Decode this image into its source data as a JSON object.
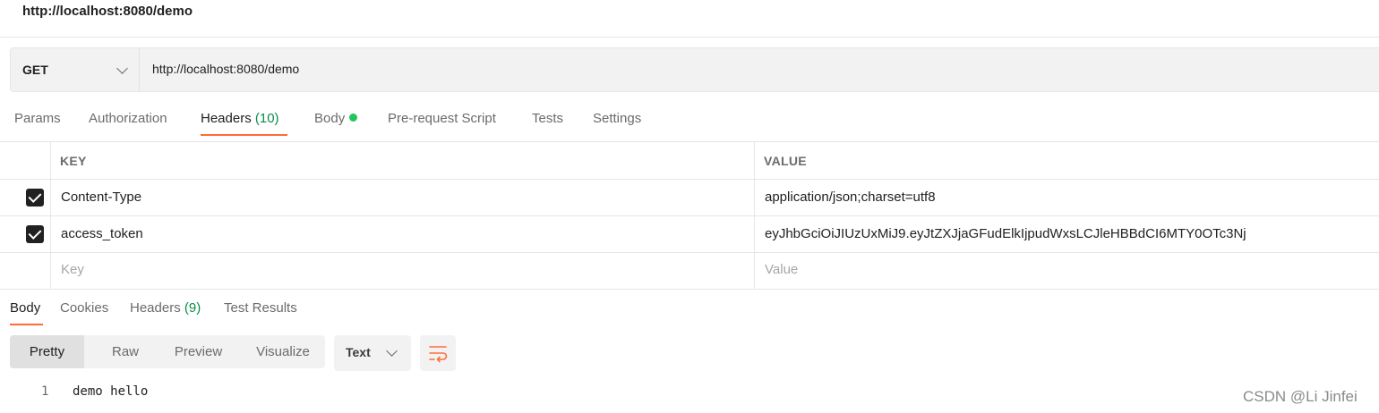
{
  "window": {
    "title": "http://localhost:8080/demo"
  },
  "request": {
    "method": "GET",
    "url": "http://localhost:8080/demo"
  },
  "request_tabs": [
    {
      "label": "Params"
    },
    {
      "label": "Authorization"
    },
    {
      "label": "Headers",
      "count": "(10)"
    },
    {
      "label": "Body"
    },
    {
      "label": "Pre-request Script"
    },
    {
      "label": "Tests"
    },
    {
      "label": "Settings"
    }
  ],
  "headers_table": {
    "columns": [
      "KEY",
      "VALUE"
    ],
    "rows": [
      {
        "checked": true,
        "key": "Content-Type",
        "value": "application/json;charset=utf8"
      },
      {
        "checked": true,
        "key": "access_token",
        "value": "eyJhbGciOiJIUzUxMiJ9.eyJtZXJjaGFudElkIjpudWxsLCJleHBBdCI6MTY0OTc3Nj"
      }
    ],
    "placeholder": {
      "key": "Key",
      "value": "Value"
    }
  },
  "response_tabs": [
    {
      "label": "Body"
    },
    {
      "label": "Cookies"
    },
    {
      "label": "Headers",
      "count": "(9)"
    },
    {
      "label": "Test Results"
    }
  ],
  "view_modes": [
    "Pretty",
    "Raw",
    "Preview",
    "Visualize"
  ],
  "format_select": "Text",
  "code_lines": [
    {
      "num": "1",
      "text": "demo hello"
    }
  ],
  "watermark": "CSDN @Li Jinfei",
  "colors": {
    "accent": "#ff6c37",
    "body_dot": "#22c55e",
    "count_green": "#0b8a4a"
  },
  "icons": {
    "word_wrap": "wrap-lines-icon"
  }
}
